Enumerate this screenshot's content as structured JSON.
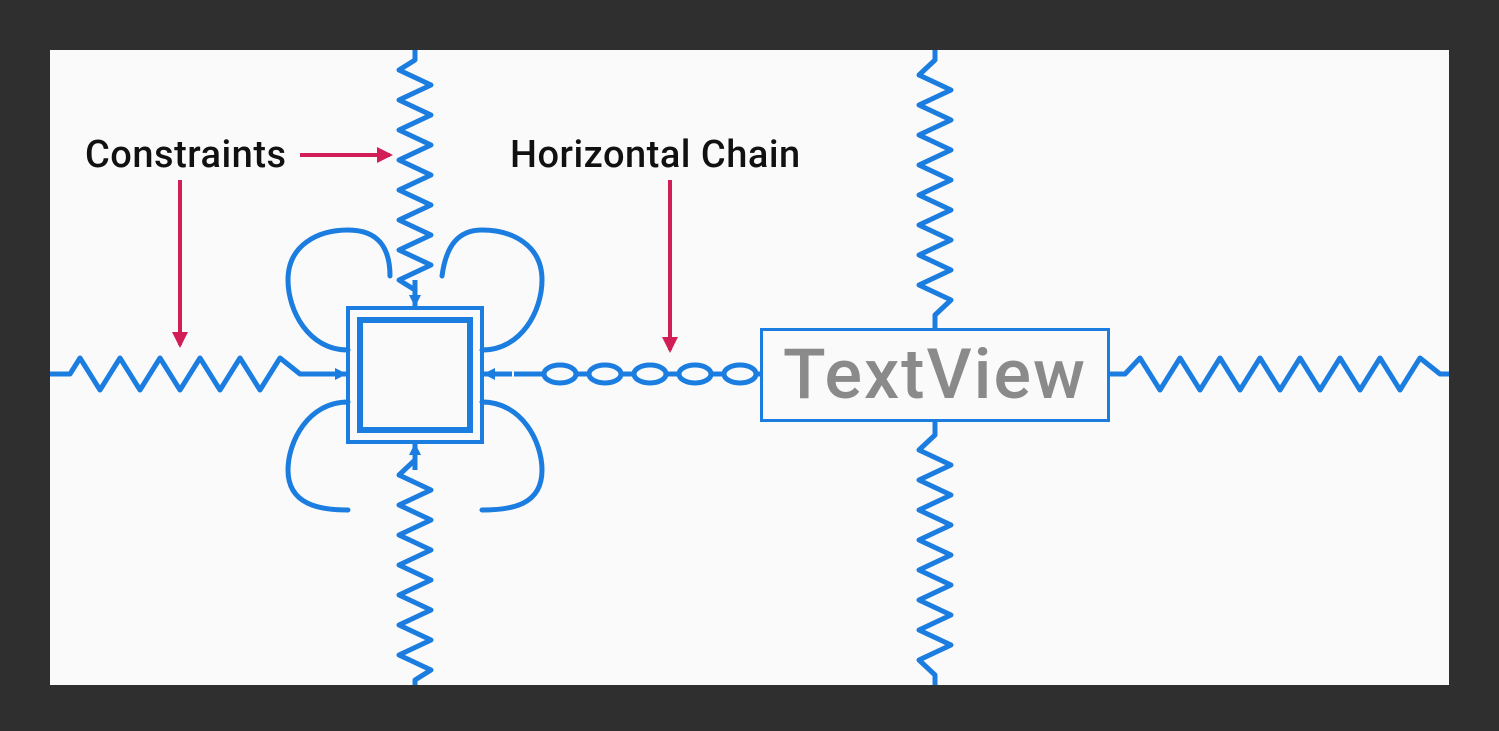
{
  "labels": {
    "constraints": "Constraints",
    "horizontal_chain": "Horizontal Chain"
  },
  "views": {
    "textview_label": "TextView"
  },
  "colors": {
    "constraint_blue": "#1b7de0",
    "annotation_red": "#d21e56",
    "background_dark": "#2f2f2f",
    "canvas_bg": "#fafafa",
    "placeholder_gray": "#8a8a8a"
  }
}
